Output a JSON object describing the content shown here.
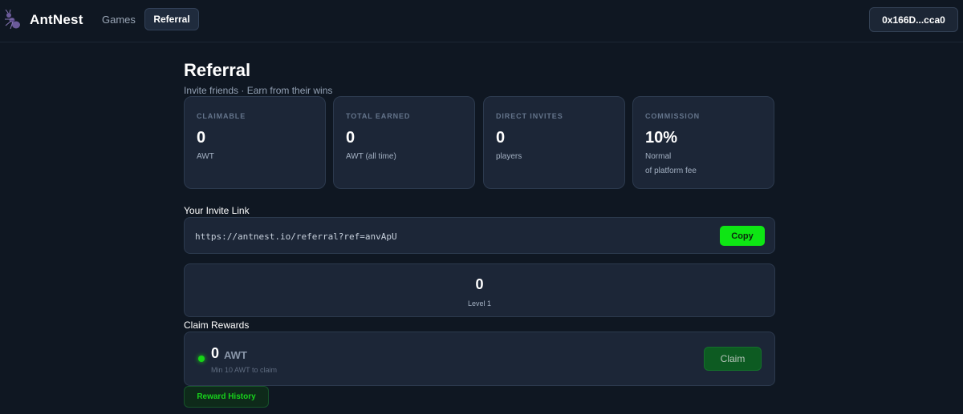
{
  "header": {
    "brand": "AntNest",
    "logo_icon": "ant-icon",
    "nav": {
      "games": "Games",
      "referral": "Referral"
    },
    "wallet": "0x166D...cca0"
  },
  "page": {
    "title": "Referral",
    "subtitle": "Invite friends · Earn from their wins"
  },
  "stats": [
    {
      "label": "CLAIMABLE",
      "value": "0",
      "unit": "AWT",
      "unit2": ""
    },
    {
      "label": "TOTAL EARNED",
      "value": "0",
      "unit": "AWT (all time)",
      "unit2": ""
    },
    {
      "label": "DIRECT INVITES",
      "value": "0",
      "unit": "players",
      "unit2": ""
    },
    {
      "label": "COMMISSION",
      "value": "10%",
      "unit": "Normal",
      "unit2": "of platform fee"
    }
  ],
  "invite": {
    "label": "Your Invite Link",
    "url": "https://antnest.io/referral?ref=anvApU",
    "copy_label": "Copy"
  },
  "levels": {
    "count": "0",
    "label": "Level 1"
  },
  "claim": {
    "section_label": "Claim Rewards",
    "amount": "0",
    "unit": "AWT",
    "note": "Min 10 AWT to claim",
    "button_label": "Claim"
  },
  "history_button_label": "Reward History",
  "colors": {
    "background": "#0f1722",
    "card": "#1c2637",
    "accent_green": "#0ee614"
  }
}
